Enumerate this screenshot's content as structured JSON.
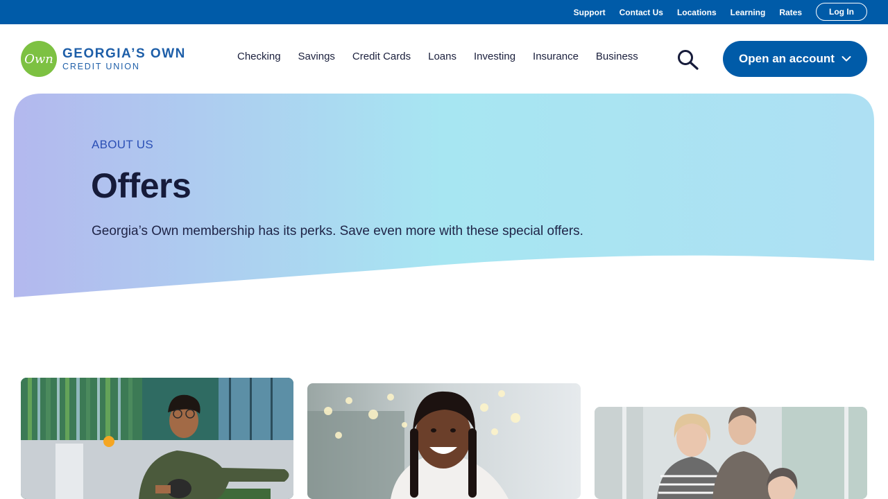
{
  "utility_nav": {
    "links": [
      "Support",
      "Contact Us",
      "Locations",
      "Learning",
      "Rates"
    ],
    "login_label": "Log In"
  },
  "brand": {
    "logo_mark": "Own",
    "name_line1": "GEORGIA’S OWN",
    "name_line2": "CREDIT UNION",
    "green": "#7dc142",
    "blue": "#005ba8"
  },
  "main_nav": {
    "items": [
      "Checking",
      "Savings",
      "Credit Cards",
      "Loans",
      "Investing",
      "Insurance",
      "Business"
    ],
    "search_icon": "search-icon",
    "cta_label": "Open an account",
    "cta_icon": "chevron-down-icon"
  },
  "hero": {
    "eyebrow": "ABOUT US",
    "title": "Offers",
    "description": "Georgia’s Own membership has its perks. Save even more with these special offers.",
    "gradient_start": "#b3b8ee",
    "gradient_end": "#a7e6f2"
  },
  "cards": [
    {
      "image": "man-playing-ping-pong-photo"
    },
    {
      "image": "smiling-girl-holiday-lights-photo"
    },
    {
      "image": "family-dinner-photo"
    }
  ]
}
